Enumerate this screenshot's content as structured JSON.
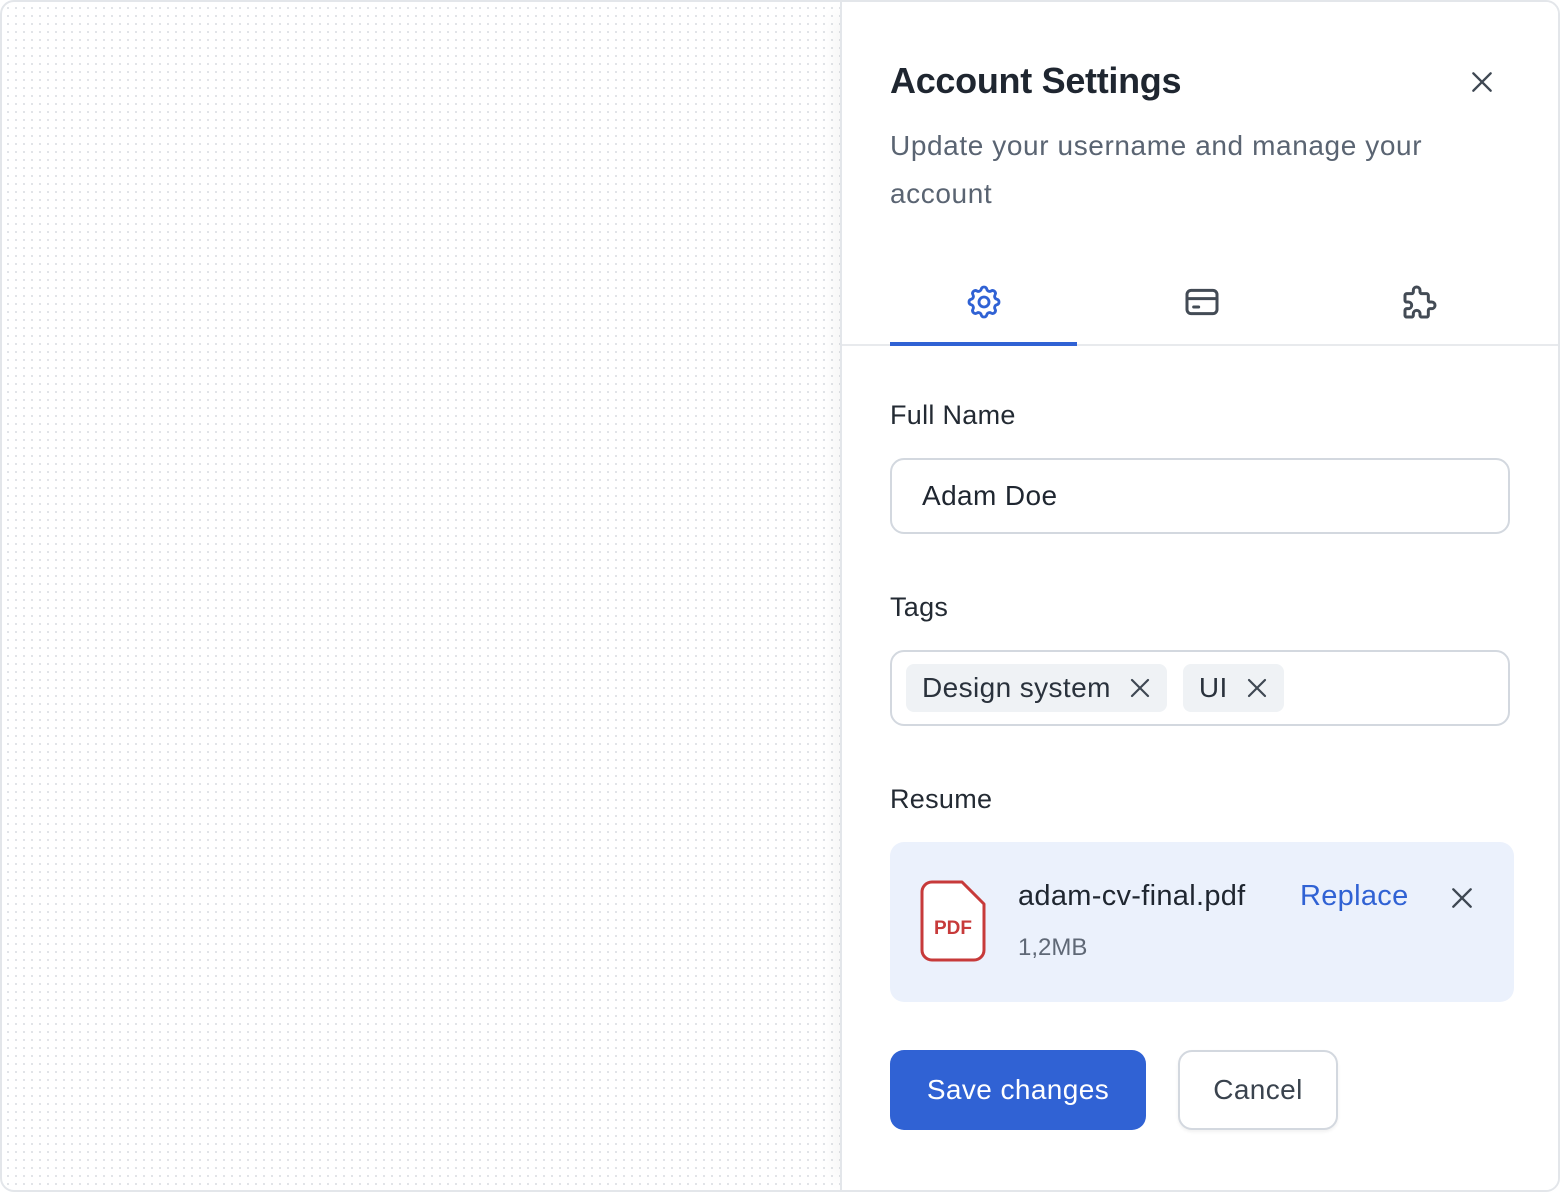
{
  "panel": {
    "title": "Account Settings",
    "subtitle": "Update your username and manage your account",
    "close_icon": "close-icon"
  },
  "tabs": [
    {
      "icon": "gear-icon",
      "label": "Settings",
      "active": true
    },
    {
      "icon": "credit-card-icon",
      "label": "Billing",
      "active": false
    },
    {
      "icon": "puzzle-icon",
      "label": "Integrations",
      "active": false
    }
  ],
  "form": {
    "full_name": {
      "label": "Full Name",
      "value": "Adam Doe"
    },
    "tags": {
      "label": "Tags",
      "items": [
        "Design system",
        "UI"
      ]
    },
    "resume": {
      "label": "Resume",
      "file_name": "adam-cv-final.pdf",
      "file_size": "1,2MB",
      "file_type": "PDF",
      "replace_label": "Replace"
    }
  },
  "actions": {
    "save_label": "Save changes",
    "cancel_label": "Cancel"
  },
  "colors": {
    "accent": "#3062d4",
    "pdf_red": "#c73a3a",
    "file_card_bg": "#ebf1fc"
  }
}
